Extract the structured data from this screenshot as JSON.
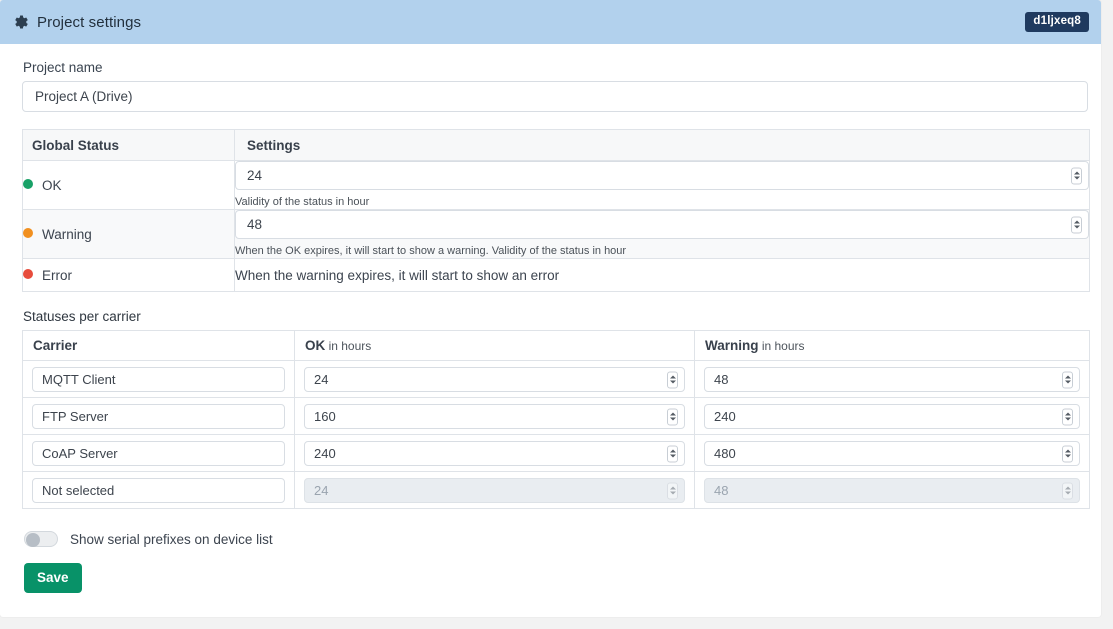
{
  "header": {
    "icon": "gear-icon",
    "title": "Project settings",
    "badge": "d1ljxeq8",
    "bg_color": "#b2d1ed",
    "badge_bg": "#1f3a5f"
  },
  "project": {
    "label": "Project name",
    "value": "Project A (Drive)",
    "placeholder": "Project name"
  },
  "global_status": {
    "columns": [
      "Global Status",
      "Settings"
    ],
    "rows": [
      {
        "status": "OK",
        "dot_color": "#18a167",
        "value": "24",
        "helper": "Validity of the status in hour",
        "has_input": true,
        "striped": false
      },
      {
        "status": "Warning",
        "dot_color": "#f19020",
        "value": "48",
        "helper": "When the OK expires, it will start to show a warning. Validity of the status in hour",
        "has_input": true,
        "striped": true
      },
      {
        "status": "Error",
        "dot_color": "#e74c3c",
        "value": "",
        "helper": "",
        "text": "When the warning expires, it will start to show an error",
        "has_input": false,
        "striped": false
      }
    ]
  },
  "carriers": {
    "section_label": "Statuses per carrier",
    "columns": [
      {
        "strong": "Carrier",
        "light": ""
      },
      {
        "strong": "OK",
        "light": " in hours"
      },
      {
        "strong": "Warning",
        "light": " in hours"
      }
    ],
    "rows": [
      {
        "carrier": "MQTT Client",
        "ok": "24",
        "warning": "48",
        "disabled": false
      },
      {
        "carrier": "FTP Server",
        "ok": "160",
        "warning": "240",
        "disabled": false
      },
      {
        "carrier": "CoAP Server",
        "ok": "240",
        "warning": "480",
        "disabled": false
      },
      {
        "carrier": "Not selected",
        "ok": "24",
        "warning": "48",
        "disabled": true
      }
    ]
  },
  "toggle": {
    "label": "Show serial prefixes on device list",
    "checked": false
  },
  "save": {
    "label": "Save",
    "color": "#089268"
  }
}
